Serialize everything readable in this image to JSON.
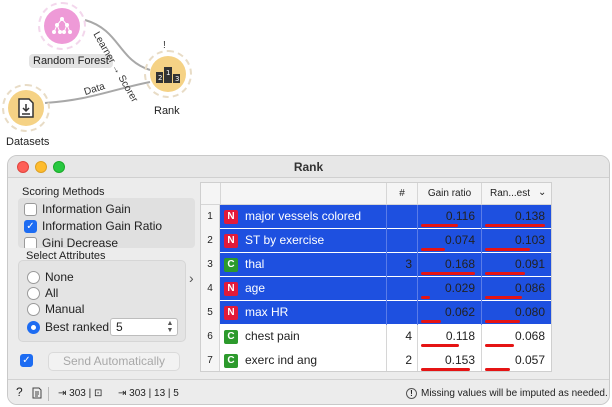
{
  "canvas": {
    "nodes": [
      {
        "id": "random-forest",
        "label": "Random Forest",
        "icon": "tree-ensemble-icon"
      },
      {
        "id": "rank",
        "label": "Rank",
        "icon": "rank-podium-icon",
        "warning": "!"
      },
      {
        "id": "datasets",
        "label": "Datasets",
        "icon": "download-file-icon"
      }
    ],
    "links": [
      {
        "label": "Learner → Scorer"
      },
      {
        "label": "Data"
      }
    ]
  },
  "window": {
    "title": "Rank",
    "scoring": {
      "title": "Scoring Methods",
      "methods": [
        {
          "label": "Information Gain",
          "checked": false
        },
        {
          "label": "Information Gain Ratio",
          "checked": true
        },
        {
          "label": "Gini Decrease",
          "checked": false
        }
      ]
    },
    "select": {
      "title": "Select Attributes",
      "options": [
        {
          "label": "None",
          "selected": false
        },
        {
          "label": "All",
          "selected": false
        },
        {
          "label": "Manual",
          "selected": false
        },
        {
          "label": "Best ranked:",
          "selected": true
        }
      ],
      "best_ranked_value": "5"
    },
    "send_auto": {
      "label": "Send Automatically",
      "checked": true
    },
    "table": {
      "headers": {
        "num": "#",
        "gain": "Gain ratio",
        "ran": "Ran...est"
      },
      "rows": [
        {
          "idx": "1",
          "type": "N",
          "name": "major vessels colored",
          "count": "",
          "gain": "0.116",
          "gain_frac": 0.69,
          "ran": "0.138",
          "ran_frac": 1.0,
          "selected": true
        },
        {
          "idx": "2",
          "type": "N",
          "name": "ST by exercise",
          "count": "",
          "gain": "0.074",
          "gain_frac": 0.44,
          "ran": "0.103",
          "ran_frac": 0.75,
          "selected": true
        },
        {
          "idx": "3",
          "type": "C",
          "name": "thal",
          "count": "3",
          "gain": "0.168",
          "gain_frac": 1.0,
          "ran": "0.091",
          "ran_frac": 0.66,
          "selected": true
        },
        {
          "idx": "4",
          "type": "N",
          "name": "age",
          "count": "",
          "gain": "0.029",
          "gain_frac": 0.17,
          "ran": "0.086",
          "ran_frac": 0.62,
          "selected": true
        },
        {
          "idx": "5",
          "type": "N",
          "name": "max HR",
          "count": "",
          "gain": "0.062",
          "gain_frac": 0.37,
          "ran": "0.080",
          "ran_frac": 0.58,
          "selected": true
        },
        {
          "idx": "6",
          "type": "C",
          "name": "chest pain",
          "count": "4",
          "gain": "0.118",
          "gain_frac": 0.7,
          "ran": "0.068",
          "ran_frac": 0.49,
          "selected": false
        },
        {
          "idx": "7",
          "type": "C",
          "name": "exerc ind ang",
          "count": "2",
          "gain": "0.153",
          "gain_frac": 0.91,
          "ran": "0.057",
          "ran_frac": 0.41,
          "selected": false
        }
      ]
    },
    "status": {
      "input_summary": "303 | ⊡",
      "output_summary": "303 | 13 | 5",
      "warning": "Missing values will be imputed as needed."
    },
    "colors": {
      "selection": "#1e50e0",
      "bar": "#e51414",
      "numeric_badge": "#e21a3a",
      "categorical_badge": "#2c9a2c"
    }
  }
}
